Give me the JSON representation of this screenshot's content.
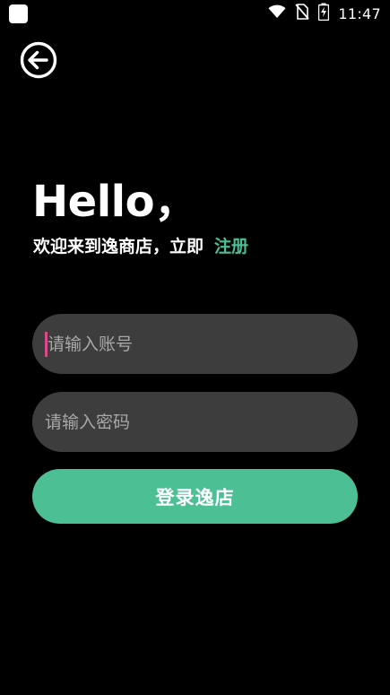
{
  "status_bar": {
    "time": "11:47",
    "icons": [
      "app-indicator-icon",
      "wifi-icon",
      "no-sim-icon",
      "battery-charging-icon"
    ]
  },
  "header": {
    "back_icon": "back-arrow-circle-icon"
  },
  "main": {
    "title": "Hello，",
    "welcome_text": "欢迎来到逸商店，立即",
    "register_link": "注册",
    "account_placeholder": "请输入账号",
    "password_placeholder": "请输入密码",
    "login_button": "登录逸店"
  },
  "colors": {
    "background": "#000000",
    "accent": "#4dbf94",
    "input_bg": "#3d3d3d",
    "caret": "#d94a8c"
  }
}
